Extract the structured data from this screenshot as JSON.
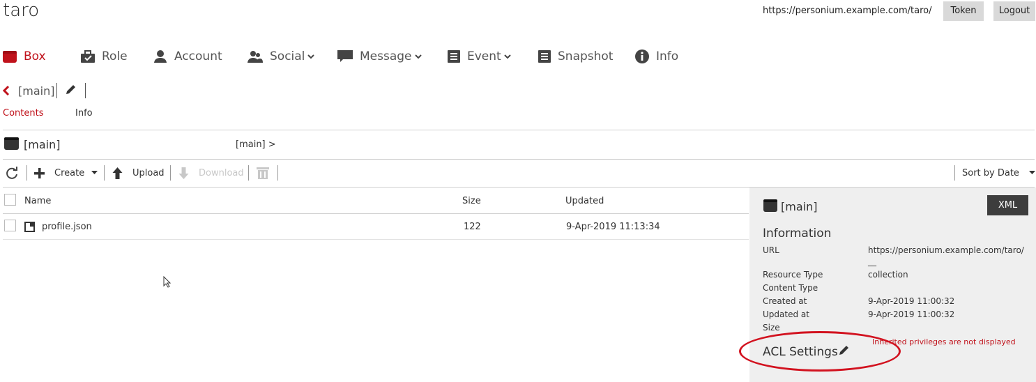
{
  "header": {
    "cell_name": "taro",
    "cell_url": "https://personium.example.com/taro/",
    "token_label": "Token",
    "logout_label": "Logout"
  },
  "nav": {
    "items": [
      {
        "label": "Box",
        "icon": "box-icon",
        "active": true
      },
      {
        "label": "Role",
        "icon": "briefcase-icon"
      },
      {
        "label": "Account",
        "icon": "user-icon"
      },
      {
        "label": "Social",
        "icon": "social-icon",
        "dropdown": true
      },
      {
        "label": "Message",
        "icon": "comment-icon",
        "dropdown": true
      },
      {
        "label": "Event",
        "icon": "list-icon",
        "dropdown": true
      },
      {
        "label": "Snapshot",
        "icon": "list-icon"
      },
      {
        "label": "Info",
        "icon": "info-icon"
      }
    ]
  },
  "box": {
    "name": "[main]",
    "tabs": [
      "Contents",
      "Info"
    ]
  },
  "path": {
    "title": "[main]",
    "breadcrumb": "[main] >"
  },
  "toolbar": {
    "create_label": "Create",
    "upload_label": "Upload",
    "download_label": "Download",
    "sort_label": "Sort by Date"
  },
  "table": {
    "columns": [
      "Name",
      "Size",
      "Updated"
    ],
    "rows": [
      {
        "name": "profile.json",
        "size": "122",
        "updated": "9-Apr-2019 11:13:34"
      }
    ]
  },
  "panel": {
    "title": "[main]",
    "xml_label": "XML",
    "info_heading": "Information",
    "fields": [
      {
        "label": "URL",
        "value": "https://personium.example.com/taro/"
      },
      {
        "label": "Resource Type",
        "value": "collection"
      },
      {
        "label": "Content Type",
        "value": ""
      },
      {
        "label": "Created at",
        "value": "9-Apr-2019 11:00:32"
      },
      {
        "label": "Updated at",
        "value": "9-Apr-2019 11:00:32"
      },
      {
        "label": "Size",
        "value": ""
      }
    ],
    "url_extra": "__",
    "acl_heading": "ACL Settings",
    "acl_note": "Inherited privileges are not displayed"
  },
  "colors": {
    "accent": "#c0121b",
    "panel_bg": "#efefef",
    "annotation": "#d2121f"
  }
}
